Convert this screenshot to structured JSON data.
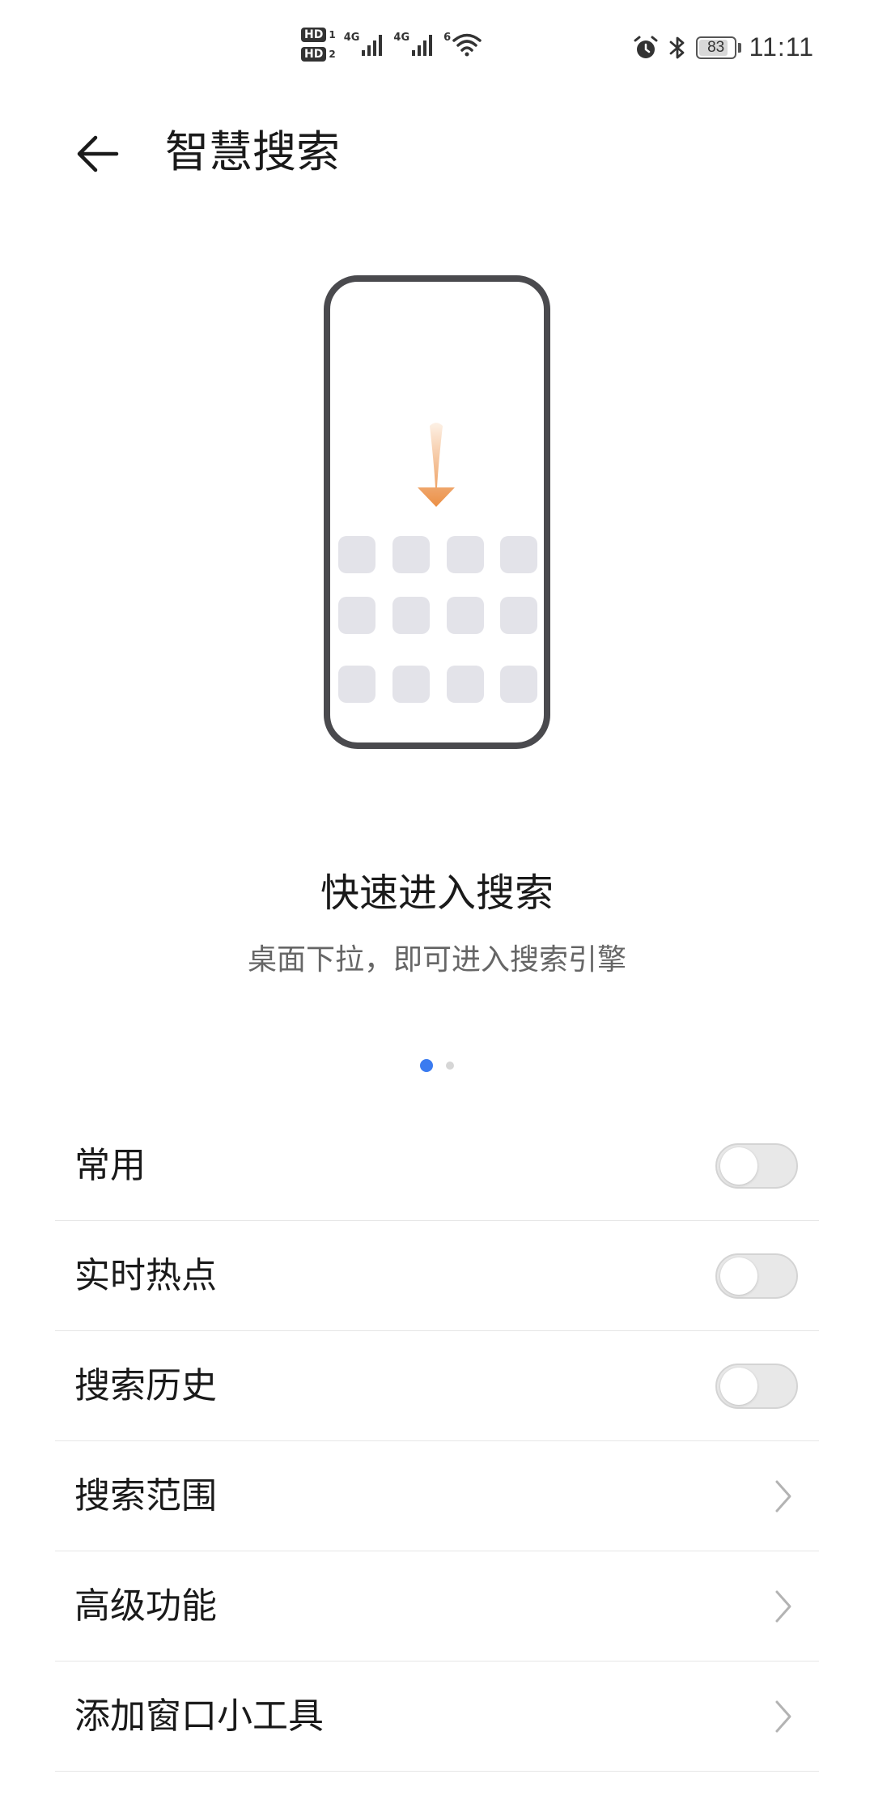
{
  "status_bar": {
    "hd1": "HD",
    "hd1_sub": "1",
    "hd2": "HD",
    "hd2_sub": "2",
    "net1": "4G",
    "net2": "4G",
    "wifi": "6",
    "battery_percent": 83,
    "battery_label": "83",
    "time": "11:11",
    "icons": [
      "alarm-icon",
      "bluetooth-icon",
      "battery-icon",
      "wifi-icon",
      "signal-icon"
    ]
  },
  "header": {
    "title": "智慧搜索",
    "back_icon": "back-arrow-icon"
  },
  "carousel": {
    "title": "快速进入搜索",
    "subtitle": "桌面下拉，即可进入搜索引擎",
    "page_count": 2,
    "active_page": 1
  },
  "settings": {
    "items": [
      {
        "label": "常用",
        "type": "toggle",
        "on": false
      },
      {
        "label": "实时热点",
        "type": "toggle",
        "on": false
      },
      {
        "label": "搜索历史",
        "type": "toggle",
        "on": false
      },
      {
        "label": "搜索范围",
        "type": "link"
      },
      {
        "label": "高级功能",
        "type": "link"
      },
      {
        "label": "添加窗口小工具",
        "type": "link"
      }
    ]
  },
  "colors": {
    "accent": "#3a7bf0",
    "arrow_top": "#fdf1e6",
    "arrow_bottom": "#eb8f45",
    "app_tile": "#e3e3e9",
    "phone_frame": "#4a4a4e",
    "divider": "#e6e6e6"
  }
}
